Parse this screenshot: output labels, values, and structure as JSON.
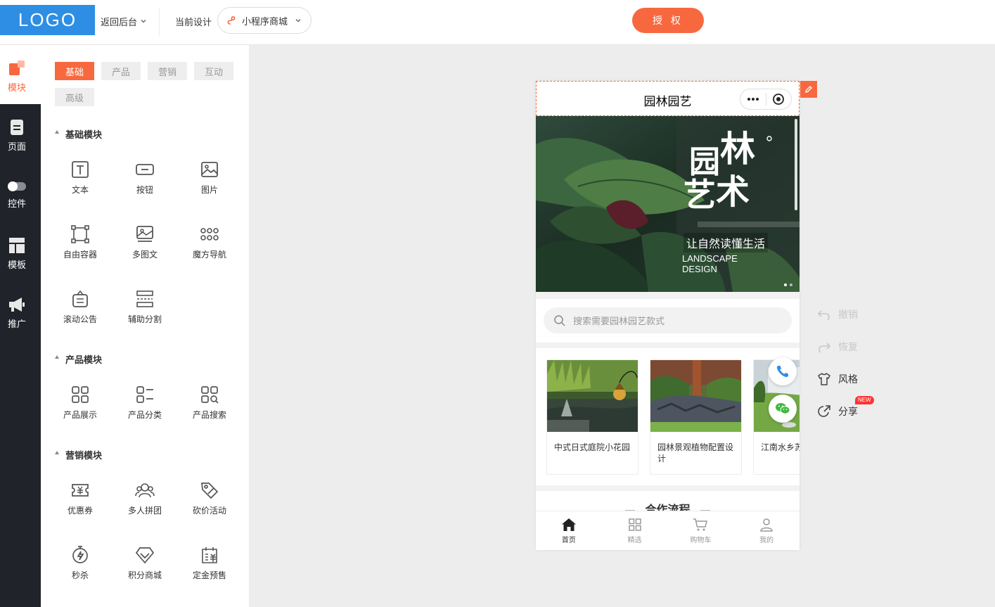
{
  "header": {
    "logo": "LOGO",
    "back_label": "返回后台",
    "current_design_label": "当前设计",
    "design_select_value": "小程序商城",
    "auth_button": "授 权"
  },
  "leftnav": {
    "items": [
      {
        "label": "模块",
        "icon": "module-icon"
      },
      {
        "label": "页面",
        "icon": "page-icon"
      },
      {
        "label": "控件",
        "icon": "toggle-icon"
      },
      {
        "label": "模板",
        "icon": "template-icon"
      },
      {
        "label": "推广",
        "icon": "megaphone-icon"
      }
    ]
  },
  "panel": {
    "tabs": [
      "基础",
      "产品",
      "营销",
      "互动",
      "高级"
    ],
    "sections": [
      {
        "title": "基础模块",
        "items": [
          "文本",
          "按钮",
          "图片",
          "自由容器",
          "多图文",
          "魔方导航",
          "滚动公告",
          "辅助分割"
        ]
      },
      {
        "title": "产品模块",
        "items": [
          "产品展示",
          "产品分类",
          "产品搜索"
        ]
      },
      {
        "title": "营销模块",
        "items": [
          "优惠券",
          "多人拼团",
          "砍价活动",
          "秒杀",
          "积分商城",
          "定金预售"
        ]
      }
    ]
  },
  "phone": {
    "title": "园林园艺",
    "banner": {
      "calligraphy": "园林艺术",
      "subtitle": "让自然读懂生活",
      "english_line1": "LANDSCAPE",
      "english_line2": "DESIGN"
    },
    "search_placeholder": "搜索需要园林园艺款式",
    "products": [
      {
        "name": "中式日式庭院小花园"
      },
      {
        "name": "园林景观植物配置设计"
      },
      {
        "name": "江南水乡苏林景观"
      }
    ],
    "section_title": "合作流程",
    "tabbar": [
      {
        "label": "首页",
        "icon": "home-icon"
      },
      {
        "label": "精选",
        "icon": "grid-icon"
      },
      {
        "label": "购物车",
        "icon": "cart-icon"
      },
      {
        "label": "我的",
        "icon": "user-icon"
      }
    ]
  },
  "tools": {
    "undo": "撤销",
    "redo": "恢复",
    "style": "风格",
    "share": "分享",
    "share_badge": "NEW"
  },
  "colors": {
    "accent": "#f8683f",
    "sidebar_dark": "#202329",
    "logo_bg": "#2d8ee4"
  }
}
